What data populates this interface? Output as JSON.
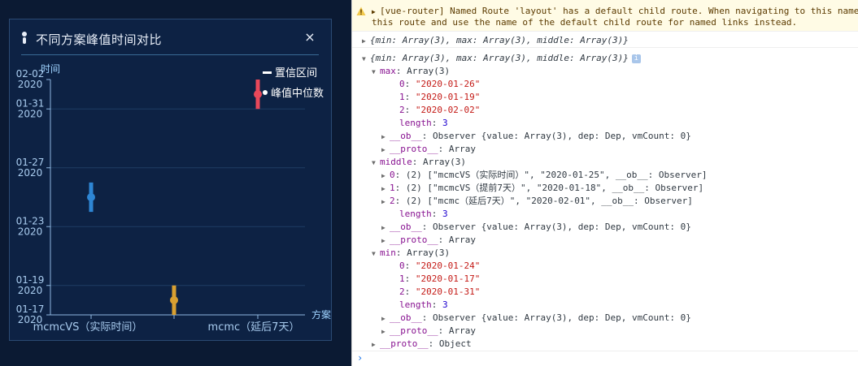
{
  "panel": {
    "title": "不同方案峰值时间对比",
    "close_label": "×"
  },
  "chart_data": {
    "type": "scatter",
    "title": "",
    "xlabel": "方案",
    "ylabel": "时间",
    "categories": [
      "mcmcVS（实际时间）",
      "mcmcVS（提前7天）",
      "mcmc（延后7天）"
    ],
    "x_tick_labels": [
      "mcmcVS（实际时间）",
      "mcmc（延后7天）"
    ],
    "y_ticks": [
      {
        "label1": "02-02",
        "label2": "2020",
        "value": "2020-02-02"
      },
      {
        "label1": "01-31",
        "label2": "2020",
        "value": "2020-01-31"
      },
      {
        "label1": "01-27",
        "label2": "2020",
        "value": "2020-01-27"
      },
      {
        "label1": "01-23",
        "label2": "2020",
        "value": "2020-01-23"
      },
      {
        "label1": "01-19",
        "label2": "2020",
        "value": "2020-01-19"
      },
      {
        "label1": "01-17",
        "label2": "2020",
        "value": "2020-01-17"
      }
    ],
    "ylim": [
      "2020-01-17",
      "2020-02-02"
    ],
    "series": [
      {
        "name": "置信区间",
        "min": [
          "2020-01-24",
          "2020-01-17",
          "2020-01-31"
        ],
        "max": [
          "2020-01-26",
          "2020-01-19",
          "2020-02-02"
        ]
      },
      {
        "name": "峰值中位数",
        "values": [
          "2020-01-25",
          "2020-01-18",
          "2020-02-01"
        ]
      }
    ],
    "colors": [
      "#2e86d4",
      "#d9a031",
      "#e8485a"
    ],
    "grid": true,
    "legend_position": "top-right"
  },
  "console": {
    "warning_line1": "[vue-router] Named Route 'layout' has a default child route. When navigating to this named",
    "warning_line2": "this route and use the name of the default child route for named links instead.",
    "rows": [
      {
        "text": "{min: Array(3), max: Array(3), middle: Array(3)}"
      },
      {
        "text": "{min: Array(3), max: Array(3), middle: Array(3)}",
        "badge": "i"
      },
      {
        "key": "max",
        "text": ": Array(3)"
      },
      {
        "key": "0",
        "str": "\"2020-01-26\""
      },
      {
        "key": "1",
        "str": "\"2020-01-19\""
      },
      {
        "key": "2",
        "str": "\"2020-02-02\""
      },
      {
        "key": "length",
        "num": "3"
      },
      {
        "key": "__ob__",
        "text": ": Observer {value: Array(3), dep: Dep, vmCount: 0}"
      },
      {
        "key": "__proto__",
        "text": ": Array"
      },
      {
        "key": "middle",
        "text": ": Array(3)"
      },
      {
        "key": "0",
        "text": ": (2) [\"mcmcVS（实际时间）\", \"2020-01-25\", __ob__: Observer]"
      },
      {
        "key": "1",
        "text": ": (2) [\"mcmcVS（提前7天）\", \"2020-01-18\", __ob__: Observer]"
      },
      {
        "key": "2",
        "text": ": (2) [\"mcmc（延后7天）\", \"2020-02-01\", __ob__: Observer]"
      },
      {
        "key": "length",
        "num": "3"
      },
      {
        "key": "__ob__",
        "text": ": Observer {value: Array(3), dep: Dep, vmCount: 0}"
      },
      {
        "key": "__proto__",
        "text": ": Array"
      },
      {
        "key": "min",
        "text": ": Array(3)"
      },
      {
        "key": "0",
        "str": "\"2020-01-24\""
      },
      {
        "key": "1",
        "str": "\"2020-01-17\""
      },
      {
        "key": "2",
        "str": "\"2020-01-31\""
      },
      {
        "key": "length",
        "num": "3"
      },
      {
        "key": "__ob__",
        "text": ": Observer {value: Array(3), dep: Dep, vmCount: 0}"
      },
      {
        "key": "__proto__",
        "text": ": Array"
      },
      {
        "key": "__proto__",
        "text": ": Object"
      }
    ],
    "prompt_symbol": "›"
  }
}
